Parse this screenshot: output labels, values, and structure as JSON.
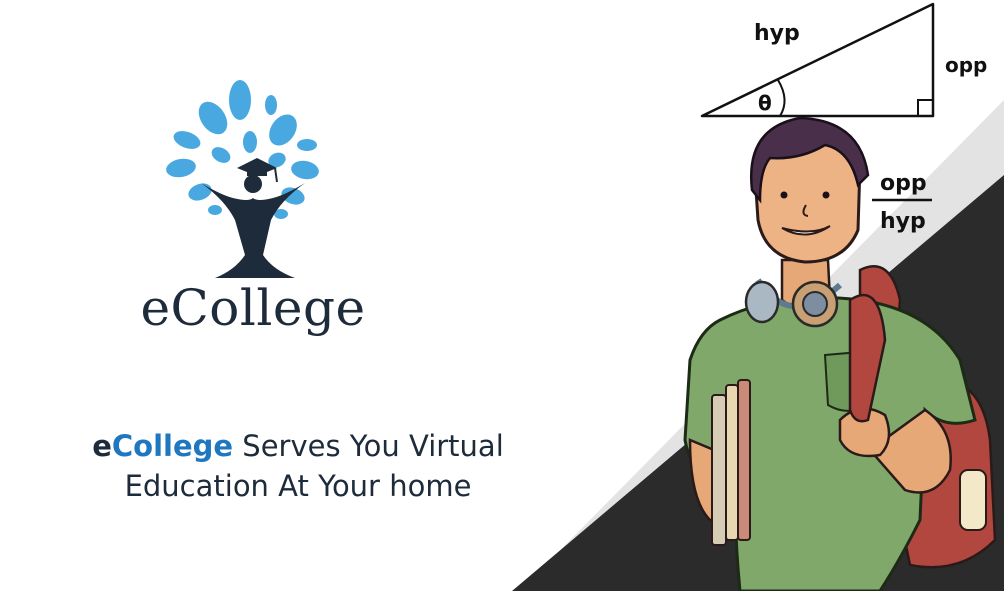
{
  "logo": {
    "name": "eCollege"
  },
  "tagline": {
    "brand_e": "e",
    "brand_rest": "College",
    "line1_rest": " Serves You Virtual",
    "line2": "Education At Your home"
  },
  "illustration": {
    "hyp_label": "hyp",
    "opp_label": "opp",
    "theta_label": "θ",
    "fraction_numerator": "opp",
    "fraction_denominator": "hyp"
  },
  "colors": {
    "brand_blue": "#1f77c0",
    "leaf_blue": "#4aa8e0",
    "navy": "#1d2b3a",
    "light_gray": "#e3e3e3",
    "dark_band": "#2b2b2b"
  }
}
